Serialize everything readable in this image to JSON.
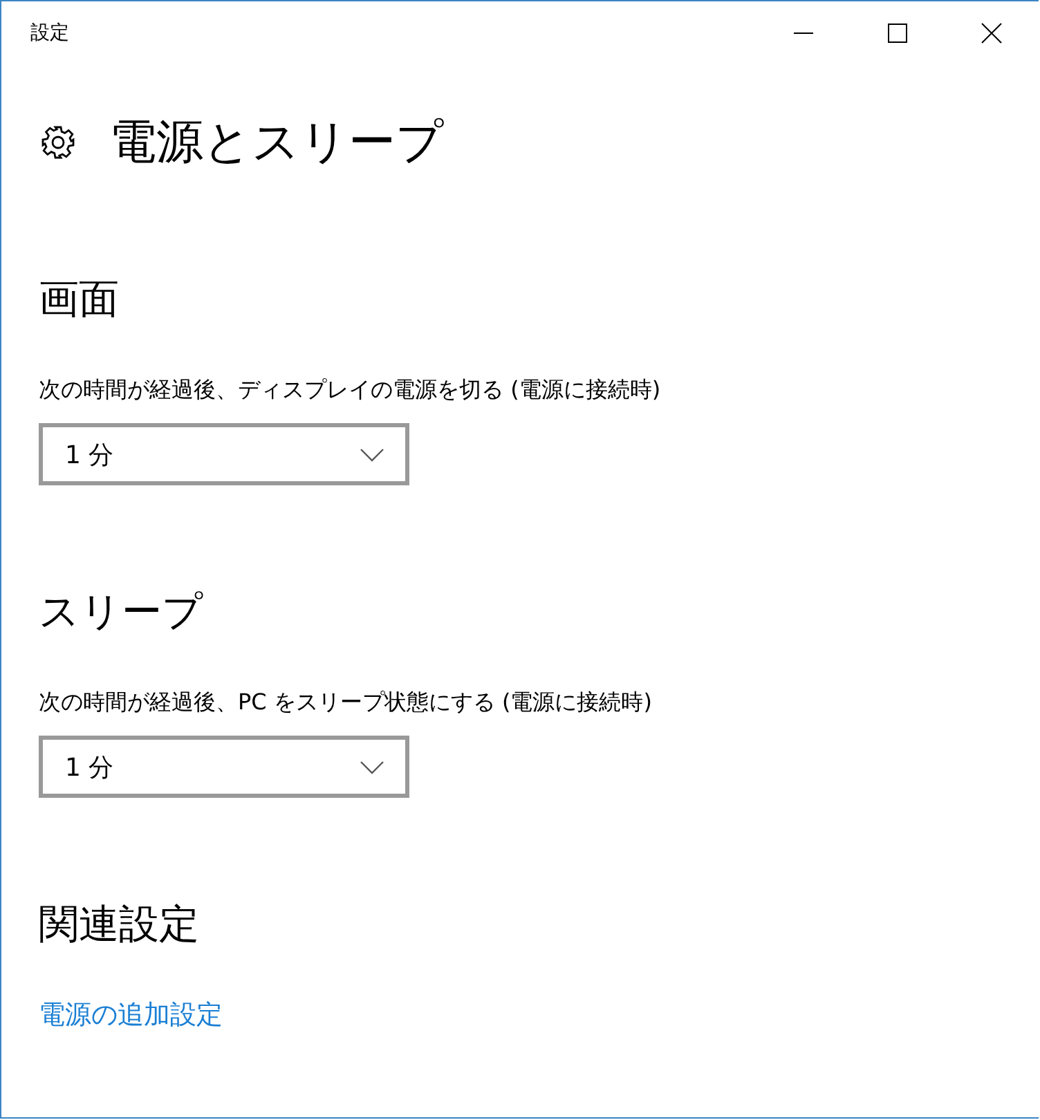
{
  "window": {
    "title": "設定"
  },
  "page": {
    "title": "電源とスリープ"
  },
  "sections": [
    {
      "kind": "dropdown",
      "heading": "画面",
      "label": "次の時間が経過後、ディスプレイの電源を切る (電源に接続時)",
      "value": "1 分"
    },
    {
      "kind": "dropdown",
      "heading": "スリープ",
      "label": "次の時間が経過後、PC をスリープ状態にする (電源に接続時)",
      "value": "1 分"
    },
    {
      "kind": "links",
      "heading": "関連設定",
      "links": [
        "電源の追加設定"
      ]
    }
  ]
}
